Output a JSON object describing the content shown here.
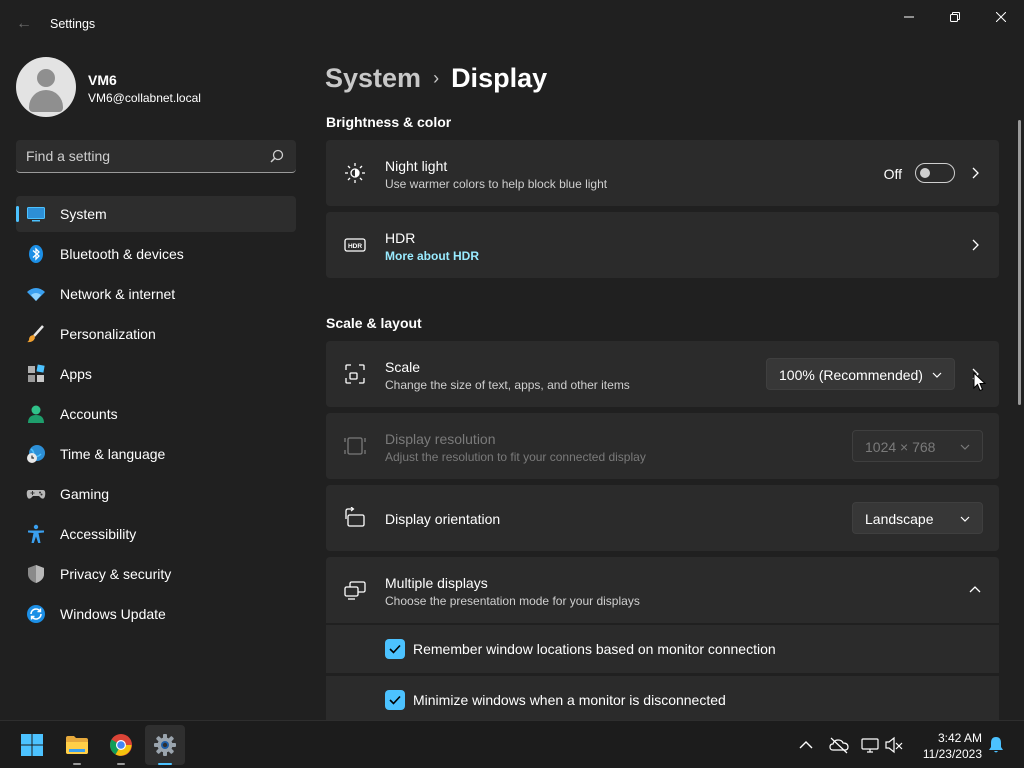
{
  "window": {
    "title": "Settings",
    "back_glyph": "←",
    "controls": [
      "minimize-icon",
      "restore-icon",
      "close-icon"
    ]
  },
  "user": {
    "name": "VM6",
    "email": "VM6@collabnet.local"
  },
  "search": {
    "placeholder": "Find a setting"
  },
  "nav": {
    "items": [
      {
        "label": "System",
        "icon": "system-icon",
        "active": true
      },
      {
        "label": "Bluetooth & devices",
        "icon": "bluetooth-icon"
      },
      {
        "label": "Network & internet",
        "icon": "wifi-icon"
      },
      {
        "label": "Personalization",
        "icon": "brush-icon"
      },
      {
        "label": "Apps",
        "icon": "apps-icon"
      },
      {
        "label": "Accounts",
        "icon": "accounts-icon"
      },
      {
        "label": "Time & language",
        "icon": "globe-clock-icon"
      },
      {
        "label": "Gaming",
        "icon": "gamepad-icon"
      },
      {
        "label": "Accessibility",
        "icon": "accessibility-icon"
      },
      {
        "label": "Privacy & security",
        "icon": "shield-icon"
      },
      {
        "label": "Windows Update",
        "icon": "update-icon"
      }
    ]
  },
  "breadcrumb": {
    "parent": "System",
    "separator": "›",
    "current": "Display"
  },
  "sections": {
    "brightness": {
      "title": "Brightness & color",
      "night_light": {
        "title": "Night light",
        "subtitle": "Use warmer colors to help block blue light",
        "state": "Off"
      },
      "hdr": {
        "title": "HDR",
        "link": "More about HDR"
      }
    },
    "scale_layout": {
      "title": "Scale & layout",
      "scale": {
        "title": "Scale",
        "subtitle": "Change the size of text, apps, and other items",
        "value": "100% (Recommended)"
      },
      "resolution": {
        "title": "Display resolution",
        "subtitle": "Adjust the resolution to fit your connected display",
        "value": "1024 × 768"
      },
      "orientation": {
        "title": "Display orientation",
        "value": "Landscape"
      },
      "multiple_displays": {
        "title": "Multiple displays",
        "subtitle": "Choose the presentation mode for your displays",
        "options": [
          {
            "label": "Remember window locations based on monitor connection",
            "checked": true
          },
          {
            "label": "Minimize windows when a monitor is disconnected",
            "checked": true
          }
        ]
      }
    }
  },
  "taskbar": {
    "apps": [
      "start-icon",
      "file-explorer-icon",
      "chrome-icon",
      "settings-icon"
    ],
    "tray": [
      "chevron-up-icon",
      "onedrive-icon",
      "network-icon",
      "volume-muted-icon",
      "notification-icon"
    ],
    "time": "3:42 AM",
    "date": "11/23/2023"
  },
  "colors": {
    "accent": "#4cc2ff",
    "link": "#99ebff",
    "background": "#202020",
    "card": "#2b2b2b"
  }
}
